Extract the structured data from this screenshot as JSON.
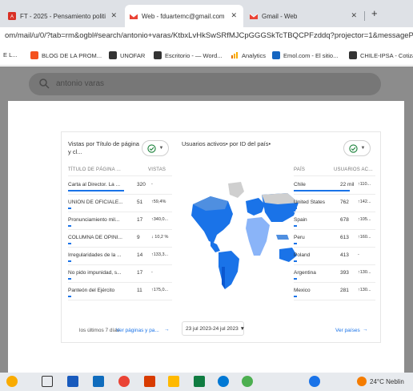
{
  "tabs": [
    {
      "label": "FT - 2025 - Pensamiento politi",
      "icon": "pdf-icon",
      "close": "✕",
      "active": false
    },
    {
      "label": "Web - fduartemc@gmail.com",
      "icon": "gmail-icon",
      "close": "✕",
      "active": true
    },
    {
      "label": "Gmail - Web",
      "icon": "gmail-icon",
      "close": "✕",
      "active": false
    }
  ],
  "new_tab": "+",
  "address": "om/mail/u/0/?tab=rm&ogbl#search/antonio+varas/KtbxLvHkSwSRfMJCpGGGSkTcTBQCPFzddq?projector=1&messagePartId=0.1",
  "bookmarks": [
    {
      "label": "E L...",
      "icon_color": ""
    },
    {
      "label": "BLOG DE LA PROM...",
      "icon_color": "#f4511e"
    },
    {
      "label": "UNOFAR",
      "icon_color": "#333333"
    },
    {
      "label": "Escritorio - — Word...",
      "icon_color": "#333333"
    },
    {
      "label": "Analytics",
      "icon_color": "#f9ab00"
    },
    {
      "label": "Emol.com - El sitio...",
      "icon_color": "#1565c0"
    },
    {
      "label": "CHILE-IPSA - Cotiza",
      "icon_color": "#333333"
    }
  ],
  "gmail_search": {
    "text": "antonio varas"
  },
  "left_panel": {
    "title": "Vistas por Título de página y cl...",
    "col_title": "TÍTULO DE PÁGINA ...",
    "col_views": "VISTAS",
    "rows": [
      {
        "title": "Carta al Director. La ...",
        "views": "320",
        "pct": "-"
      },
      {
        "title": "UNION DE OFICIALE...",
        "views": "51",
        "pct": "↑59,4%"
      },
      {
        "title": "Pronunciamiento mil...",
        "views": "17",
        "pct": "↑340,0..."
      },
      {
        "title": "COLUMNA DE OPINI...",
        "views": "9",
        "pct": "↓ 10,2 %"
      },
      {
        "title": "Irregularidades de la ...",
        "views": "14",
        "pct": "↑133,3..."
      },
      {
        "title": "No pido impunidad, s...",
        "views": "17",
        "pct": "-"
      },
      {
        "title": "Panteón del Ejército",
        "views": "11",
        "pct": "↑175,0..."
      }
    ],
    "footer_text": "los últimos 7 días",
    "footer_link": "Ver páginas y pa..."
  },
  "mid_panel": {
    "title": "Usuarios activos• por ID del país•",
    "date_range": "23 jul 2023-24 jul 2023"
  },
  "right_panel": {
    "col_country": "PAÍS",
    "col_users": "USUARIOS AC...",
    "rows": [
      {
        "country": "Chile",
        "users": "22 mil",
        "pct": "↑110..."
      },
      {
        "country": "United States",
        "users": "762",
        "pct": "↑142..."
      },
      {
        "country": "Spain",
        "users": "678",
        "pct": "↑105..."
      },
      {
        "country": "Peru",
        "users": "613",
        "pct": "↑160..."
      },
      {
        "country": "Poland",
        "users": "413",
        "pct": "-"
      },
      {
        "country": "Argentina",
        "users": "393",
        "pct": "↑130..."
      },
      {
        "country": "Mexico",
        "users": "281",
        "pct": "↑130..."
      }
    ],
    "footer_link": "Ver países"
  },
  "colors": {
    "accent": "#1a73e8",
    "check_green": "#188038"
  },
  "taskbar": {
    "weather": "24°C  Neblin"
  }
}
